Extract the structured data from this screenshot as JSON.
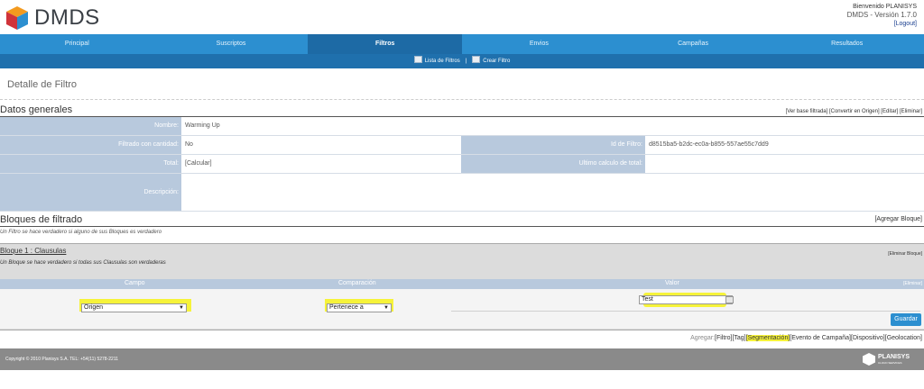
{
  "header": {
    "brand": "DMDS",
    "welcome": "Bienvenido PLANISYS",
    "version": "DMDS - Versión 1.7.0",
    "logout": "[Logout]"
  },
  "nav": {
    "items": [
      "Principal",
      "Suscriptos",
      "Filtros",
      "Envios",
      "Campañas",
      "Resultados"
    ],
    "active": "Filtros"
  },
  "subnav": {
    "lista": "Lista de Filtros",
    "separator": "|",
    "crear": "Crear Filtro"
  },
  "page_title": "Detalle de Filtro",
  "datos": {
    "title": "Datos generales",
    "links": "[Ver base filtrada] [Convertir en Origen] [Editar] [Eliminar]",
    "nombre_label": "Nombre:",
    "nombre_value": "Warming Up",
    "cantidad_label": "Filtrado con cantidad:",
    "cantidad_value": "No",
    "id_label": "Id de Filtro:",
    "id_value": "d8515ba5-b2dc-ec0a-b855-557ae55c7dd9",
    "total_label": "Total:",
    "total_value": "[Calcular]",
    "ultimo_label": "Ultimo calculo de total:",
    "ultimo_value": "",
    "desc_label": "Descripción:",
    "desc_value": ""
  },
  "bloques": {
    "title": "Bloques de filtrado",
    "agregar": "[Agregar Bloque]",
    "desc": "Un Filtro se hace verdadero si alguno de sus Bloques es verdadero"
  },
  "bloque1": {
    "title": "Bloque 1 : Clausulas",
    "eliminar": "[Eliminar Bloque]",
    "desc": "Un Bloque se hace verdadero si todas sus Clausulas son verdaderas",
    "col_campo": "Campo",
    "col_comparacion": "Comparación",
    "col_valor": "Valor",
    "eliminar_clausula": "[Eliminar]",
    "campo_value": "Origen",
    "comparacion_value": "Pertenece a",
    "valor_value": "Test",
    "guardar": "Guardar"
  },
  "agregar": {
    "prefix": "Agregar:",
    "filtro": "[Filtro]",
    "tag": "[Tag]",
    "segmentacion": "[Segmentación]",
    "evento": "[Evento de Campaña]",
    "dispositivo": "[Dispositivo]",
    "geolocation": "[Geolocation]"
  },
  "footer": {
    "copyright": "Copyright © 2010 Planisys S.A. TEL: +54(11) 5278-2211",
    "logo_text": "PLANISYS",
    "logo_sub": "CLOUD SERVICES"
  },
  "colors": {
    "nav": "#2c8fd0",
    "nav_active": "#1d6aa5",
    "label_bg": "#b8c9dd",
    "highlight": "#f6f33a"
  }
}
